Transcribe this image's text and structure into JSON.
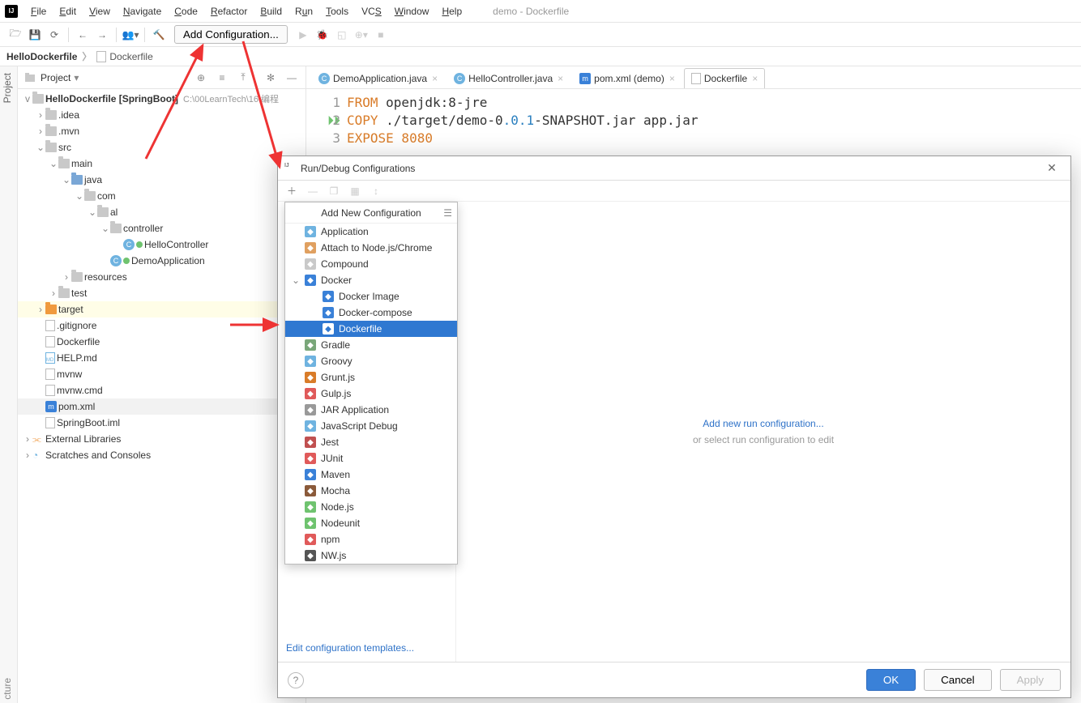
{
  "window_title": "demo - Dockerfile",
  "menu": [
    "File",
    "Edit",
    "View",
    "Navigate",
    "Code",
    "Refactor",
    "Build",
    "Run",
    "Tools",
    "VCS",
    "Window",
    "Help"
  ],
  "toolbar": {
    "add_config": "Add Configuration..."
  },
  "breadcrumb": {
    "root": "HelloDockerfile",
    "file": "Dockerfile"
  },
  "sidetab": "Project",
  "project_panel": {
    "title": "Project"
  },
  "tree": {
    "root": "HelloDockerfile",
    "root_suffix": "[SpringBoot]",
    "root_path": "C:\\00LearnTech\\16 编程",
    "nodes": [
      {
        "lvl": 1,
        "tw": ">",
        "ic": "folder-gray",
        "lbl": ".idea"
      },
      {
        "lvl": 1,
        "tw": ">",
        "ic": "folder-gray",
        "lbl": ".mvn"
      },
      {
        "lvl": 1,
        "tw": "v",
        "ic": "folder-gray",
        "lbl": "src"
      },
      {
        "lvl": 2,
        "tw": "v",
        "ic": "folder-gray",
        "lbl": "main"
      },
      {
        "lvl": 3,
        "tw": "v",
        "ic": "folder-blue",
        "lbl": "java"
      },
      {
        "lvl": 4,
        "tw": "v",
        "ic": "folder-gray",
        "lbl": "com"
      },
      {
        "lvl": 5,
        "tw": "v",
        "ic": "folder-gray",
        "lbl": "al"
      },
      {
        "lvl": 6,
        "tw": "v",
        "ic": "folder-gray",
        "lbl": "controller"
      },
      {
        "lvl": 7,
        "tw": "",
        "ic": "class",
        "lbl": "HelloController",
        "run": true
      },
      {
        "lvl": 6,
        "tw": "",
        "ic": "class",
        "lbl": "DemoApplication",
        "run": true
      },
      {
        "lvl": 3,
        "tw": ">",
        "ic": "folder-gray",
        "lbl": "resources"
      },
      {
        "lvl": 2,
        "tw": ">",
        "ic": "folder-gray",
        "lbl": "test"
      },
      {
        "lvl": 1,
        "tw": ">",
        "ic": "folder-orange",
        "lbl": "target",
        "sel": true
      },
      {
        "lvl": 1,
        "tw": "",
        "ic": "file",
        "lbl": ".gitignore"
      },
      {
        "lvl": 1,
        "tw": "",
        "ic": "file",
        "lbl": "Dockerfile"
      },
      {
        "lvl": 1,
        "tw": "",
        "ic": "file-md",
        "lbl": "HELP.md"
      },
      {
        "lvl": 1,
        "tw": "",
        "ic": "file",
        "lbl": "mvnw"
      },
      {
        "lvl": 1,
        "tw": "",
        "ic": "file",
        "lbl": "mvnw.cmd"
      },
      {
        "lvl": 1,
        "tw": "",
        "ic": "tag-m",
        "lbl": "pom.xml",
        "highl": true
      },
      {
        "lvl": 1,
        "tw": "",
        "ic": "file",
        "lbl": "SpringBoot.iml"
      }
    ],
    "ext_libs": "External Libraries",
    "scratches": "Scratches and Consoles"
  },
  "tabs": [
    {
      "ic": "class",
      "lbl": "DemoApplication.java"
    },
    {
      "ic": "class",
      "lbl": "HelloController.java"
    },
    {
      "ic": "tag-m",
      "lbl": "pom.xml (demo)"
    },
    {
      "ic": "file",
      "lbl": "Dockerfile",
      "active": true
    }
  ],
  "code": {
    "l1": {
      "kw": "FROM",
      "rest": " openjdk:8-jre"
    },
    "l2": {
      "kw": "COPY",
      "p1": " ./target/demo-0",
      "v": ".0.1",
      "p2": "-SNAPSHOT.jar app.jar"
    },
    "l3": {
      "kw": "EXPOSE",
      "port": " 8080"
    }
  },
  "dialog": {
    "title": "Run/Debug Configurations",
    "popup_title": "Add New Configuration",
    "items": [
      {
        "ic": "app",
        "lbl": "Application"
      },
      {
        "ic": "att",
        "lbl": "Attach to Node.js/Chrome"
      },
      {
        "ic": "cmp",
        "lbl": "Compound"
      },
      {
        "ic": "dock",
        "lbl": "Docker",
        "tw": "v"
      },
      {
        "ic": "docki",
        "lbl": "Docker Image",
        "indent": true
      },
      {
        "ic": "dockc",
        "lbl": "Docker-compose",
        "indent": true
      },
      {
        "ic": "dockf",
        "lbl": "Dockerfile",
        "indent": true,
        "sel": true
      },
      {
        "ic": "gradle",
        "lbl": "Gradle"
      },
      {
        "ic": "groovy",
        "lbl": "Groovy"
      },
      {
        "ic": "grunt",
        "lbl": "Grunt.js"
      },
      {
        "ic": "gulp",
        "lbl": "Gulp.js"
      },
      {
        "ic": "jar",
        "lbl": "JAR Application"
      },
      {
        "ic": "jsd",
        "lbl": "JavaScript Debug"
      },
      {
        "ic": "jest",
        "lbl": "Jest"
      },
      {
        "ic": "junit",
        "lbl": "JUnit"
      },
      {
        "ic": "maven",
        "lbl": "Maven"
      },
      {
        "ic": "mocha",
        "lbl": "Mocha"
      },
      {
        "ic": "node",
        "lbl": "Node.js"
      },
      {
        "ic": "nodeu",
        "lbl": "Nodeunit"
      },
      {
        "ic": "npm",
        "lbl": "npm"
      },
      {
        "ic": "nw",
        "lbl": "NW.js"
      }
    ],
    "right_link": "Add new run configuration...",
    "right_sub": "or select run configuration to edit",
    "edit_templates": "Edit configuration templates...",
    "ok": "OK",
    "cancel": "Cancel",
    "apply": "Apply"
  },
  "structure_tab": "cture"
}
